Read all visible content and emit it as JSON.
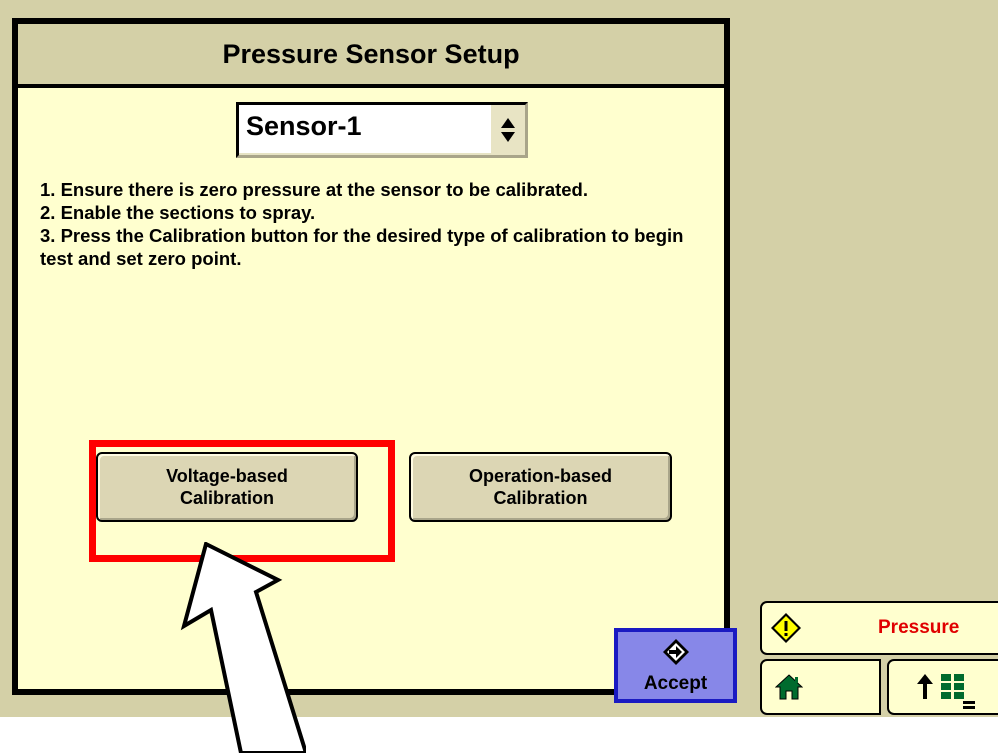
{
  "dialog": {
    "title": "Pressure Sensor Setup",
    "sensor_select": {
      "value": "Sensor-1",
      "icon": "up-down-spinner-icon"
    },
    "instructions": [
      "1. Ensure there is zero pressure at the sensor to be calibrated.",
      "2. Enable the sections to spray.",
      "3. Press the Calibration button for the desired type of calibration to begin test and set zero point."
    ],
    "buttons": {
      "voltage_line1": "Voltage-based",
      "voltage_line2": "Calibration",
      "operation_line1": "Operation-based",
      "operation_line2": "Calibration"
    },
    "accept_label": "Accept"
  },
  "status": {
    "text": "Pressure",
    "icon": "warning-diamond-icon",
    "text_color": "#e00000"
  },
  "nav": {
    "home_icon": "home-icon",
    "menu_icon": "up-arrow-menu-grid-icon"
  },
  "annotation": {
    "highlight_color": "#ff0000",
    "arrow": "white-arrow-pointing-up"
  }
}
